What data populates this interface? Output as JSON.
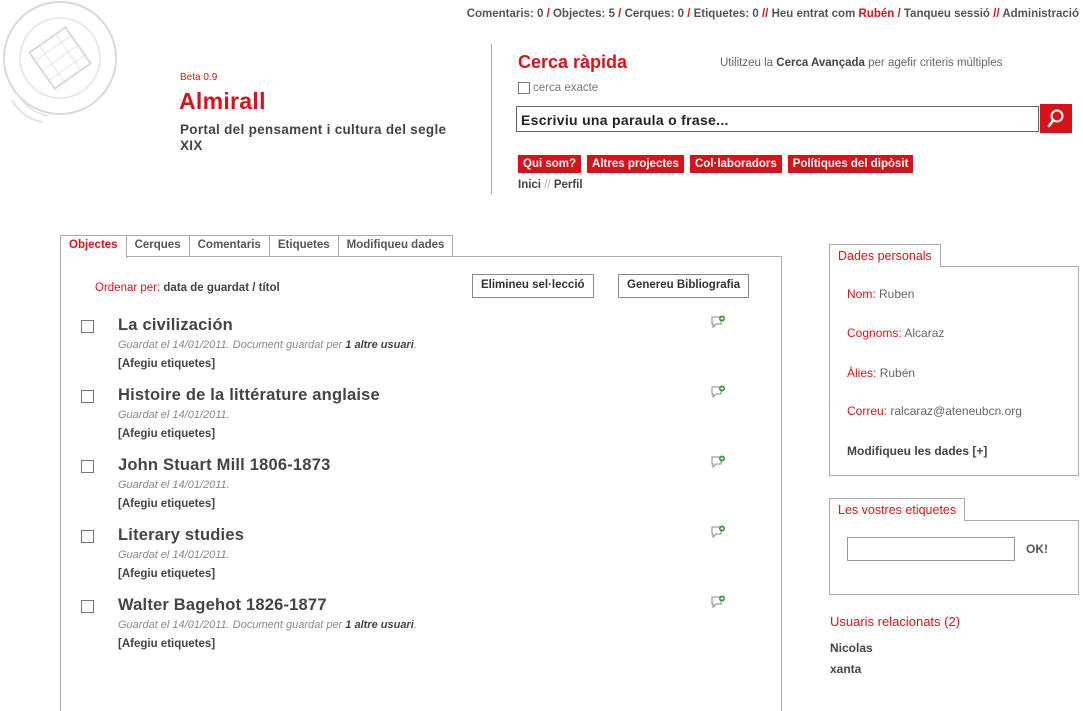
{
  "topbar": {
    "comments": "Comentaris: 0",
    "objects": "Objectes: 5",
    "searches": "Cerques: 0",
    "tags": "Etiquetes: 0",
    "logged_prefix": "Heu entrat com",
    "user": "Rubén",
    "logout": "Tanqueu sessió",
    "admin": "Administració"
  },
  "branding": {
    "beta": "Beta 0.9",
    "name": "Almirall",
    "tagline": "Portal del pensament i cultura del segle XIX",
    "seal_text": "ATENEU BARCELONES"
  },
  "quick_search": {
    "title": "Cerca ràpida",
    "hint_pre": "Utilitzeu la",
    "hint_link": "Cerca Avançada",
    "hint_post": "per agefir criteris múltiples",
    "exact_label": "cerca exacte",
    "placeholder": "Escriviu una paraula o frase...",
    "search_icon": "search-icon"
  },
  "nav": {
    "items": [
      "Qui som?",
      "Altres projectes",
      "Col·laboradors",
      "Polítiques del dipòsit"
    ],
    "breadcrumb_home": "Inici",
    "breadcrumb_sep": "//",
    "breadcrumb_current": "Perfil"
  },
  "tabs": [
    "Objectes",
    "Cerques",
    "Comentaris",
    "Etiquetes",
    "Modifiqueu dades"
  ],
  "list": {
    "order_label": "Ordenar per:",
    "order_date": "data de guardat",
    "order_sep": "/",
    "order_title": "títol",
    "delete_button": "Elimineu sel·lecció",
    "bibliography_button": "Genereu Bibliografia",
    "add_tags": "[Afegiu etiquetes]",
    "comment_icon": "comment-add-icon",
    "items": [
      {
        "title": "La civilización",
        "meta": "Guardat el 14/01/2011. Document guardat per",
        "others": "1 altre usuari",
        "tail": "."
      },
      {
        "title": "Histoire de la littérature anglaise",
        "meta": "Guardat el 14/01/2011.",
        "others": "",
        "tail": ""
      },
      {
        "title": "John Stuart Mill 1806-1873",
        "meta": "Guardat el 14/01/2011.",
        "others": "",
        "tail": ""
      },
      {
        "title": "Literary studies",
        "meta": "Guardat el 14/01/2011.",
        "others": "",
        "tail": ""
      },
      {
        "title": "Walter Bagehot 1826-1877",
        "meta": "Guardat el 14/01/2011. Document guardat per",
        "others": "1 altre usuari",
        "tail": "."
      }
    ]
  },
  "personal": {
    "tab": "Dades personals",
    "name_label": "Nom:",
    "name": "Ruben",
    "surname_label": "Cognoms:",
    "surname": "Alcaraz",
    "alias_label": "Àlies:",
    "alias": "Rubén",
    "email_label": "Correu:",
    "email": "ralcaraz@ateneubcn.org",
    "modify": "Modifiqueu les dades [+]"
  },
  "user_tags": {
    "tab": "Les vostres etiquetes",
    "ok": "OK!"
  },
  "related": {
    "title": "Usuaris relacionats (2)",
    "users": [
      "Nicolas",
      "xanta"
    ]
  },
  "colors": {
    "accent": "#d8121a",
    "border": "#aaaaaa"
  }
}
